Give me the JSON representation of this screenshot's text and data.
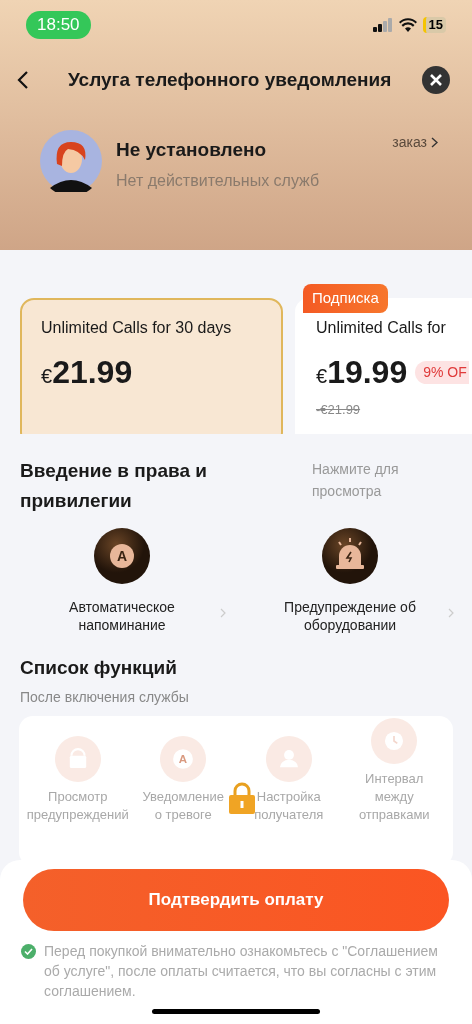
{
  "status_bar": {
    "time": "18:50",
    "battery": "15"
  },
  "header": {
    "title": "Услуга телефонного уведомления"
  },
  "profile": {
    "name": "Не установлено",
    "status": "Нет действительных служб",
    "orders_link": "заказ"
  },
  "plans": [
    {
      "title": "Unlimited Calls for 30 days",
      "currency": "€",
      "price": "21.99",
      "selected": true
    },
    {
      "badge": "Подписка",
      "title": "Unlimited Calls for",
      "currency": "€",
      "price": "19.99",
      "discount": "9% OF",
      "old_price": "-€21.99",
      "selected": false
    }
  ],
  "benefits": {
    "title": "Введение в права и привилегии",
    "hint": "Нажмите для просмотра",
    "items": [
      {
        "kind": "letter",
        "icon_text": "A",
        "label": "Автоматическое напоминание"
      },
      {
        "kind": "alarm",
        "label": "Предупреждение об оборудовании"
      }
    ]
  },
  "features": {
    "title": "Список функций",
    "subtitle": "После включения службы",
    "locked": true,
    "items": [
      {
        "kind": "bag",
        "label": "Просмотр предупреждений"
      },
      {
        "kind": "letter",
        "icon_text": "A",
        "label": "Уведомление о тревоге"
      },
      {
        "kind": "person",
        "label": "Настройка получателя"
      },
      {
        "kind": "clock",
        "label": "Интервал между отправками"
      }
    ]
  },
  "footer": {
    "button": "Подтвердить оплату",
    "agreement_checked": true,
    "agreement": "Перед покупкой внимательно ознакомьтесь с \"Соглашением об услуге\", после оплаты считается, что вы согласны с этим соглашением."
  }
}
